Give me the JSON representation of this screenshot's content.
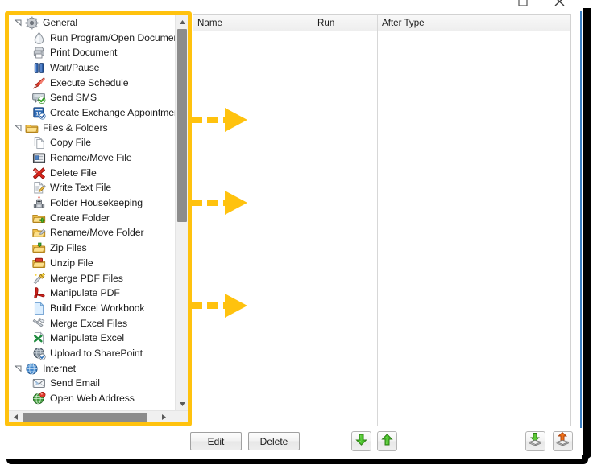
{
  "window": {
    "maximize_label": "Maximize",
    "close_label": "Close"
  },
  "tree": {
    "name": "Task type tree",
    "scroll": {
      "vertical_up": "Scroll up",
      "vertical_down": "Scroll down",
      "horizontal_left": "Scroll left",
      "horizontal_right": "Scroll right"
    },
    "groups": [
      {
        "label": "General",
        "icon": "gear-icon",
        "expanded": true,
        "items": [
          {
            "label": "Run Program/Open Document",
            "icon": "run-program-icon"
          },
          {
            "label": "Print Document",
            "icon": "printer-icon"
          },
          {
            "label": "Wait/Pause",
            "icon": "pause-icon"
          },
          {
            "label": "Execute Schedule",
            "icon": "execute-schedule-icon"
          },
          {
            "label": "Send SMS",
            "icon": "send-sms-icon"
          },
          {
            "label": "Create Exchange Appointment",
            "icon": "exchange-appointment-icon"
          }
        ]
      },
      {
        "label": "Files & Folders",
        "icon": "folder-icon",
        "expanded": true,
        "items": [
          {
            "label": "Copy File",
            "icon": "copy-file-icon"
          },
          {
            "label": "Rename/Move File",
            "icon": "rename-move-file-icon"
          },
          {
            "label": "Delete File",
            "icon": "delete-file-icon"
          },
          {
            "label": "Write Text File",
            "icon": "write-text-file-icon"
          },
          {
            "label": "Folder Housekeeping",
            "icon": "robot-icon"
          },
          {
            "label": "Create Folder",
            "icon": "create-folder-icon"
          },
          {
            "label": "Rename/Move Folder",
            "icon": "rename-move-folder-icon"
          },
          {
            "label": "Zip Files",
            "icon": "zip-files-icon"
          },
          {
            "label": "Unzip File",
            "icon": "unzip-file-icon"
          },
          {
            "label": "Merge PDF Files",
            "icon": "merge-pdf-icon"
          },
          {
            "label": "Manipulate PDF",
            "icon": "pdf-icon"
          },
          {
            "label": "Build Excel Workbook",
            "icon": "build-excel-workbook-icon"
          },
          {
            "label": "Merge Excel Files",
            "icon": "merge-excel-icon"
          },
          {
            "label": "Manipulate Excel",
            "icon": "manipulate-excel-icon"
          },
          {
            "label": "Upload to SharePoint",
            "icon": "sharepoint-icon"
          }
        ]
      },
      {
        "label": "Internet",
        "icon": "globe-icon",
        "expanded": true,
        "items": [
          {
            "label": "Send Email",
            "icon": "send-email-icon"
          },
          {
            "label": "Open Web Address",
            "icon": "open-web-address-icon"
          }
        ]
      }
    ]
  },
  "grid": {
    "columns": [
      {
        "label": "Name"
      },
      {
        "label": "Run"
      },
      {
        "label": "After Type"
      },
      {
        "label": ""
      }
    ],
    "rows": []
  },
  "toolbar": {
    "edit": {
      "mnemonic": "E",
      "rest": "dit"
    },
    "delete": {
      "mnemonic": "D",
      "rest": "elete"
    },
    "move_down_label": "Move Down",
    "move_up_label": "Move Up",
    "import_label": "Import",
    "export_label": "Export"
  },
  "annotations": {
    "arrows": [
      {
        "name": "annotation-arrow-1"
      },
      {
        "name": "annotation-arrow-2"
      },
      {
        "name": "annotation-arrow-3"
      }
    ],
    "highlight_color": "#FFC20E"
  }
}
